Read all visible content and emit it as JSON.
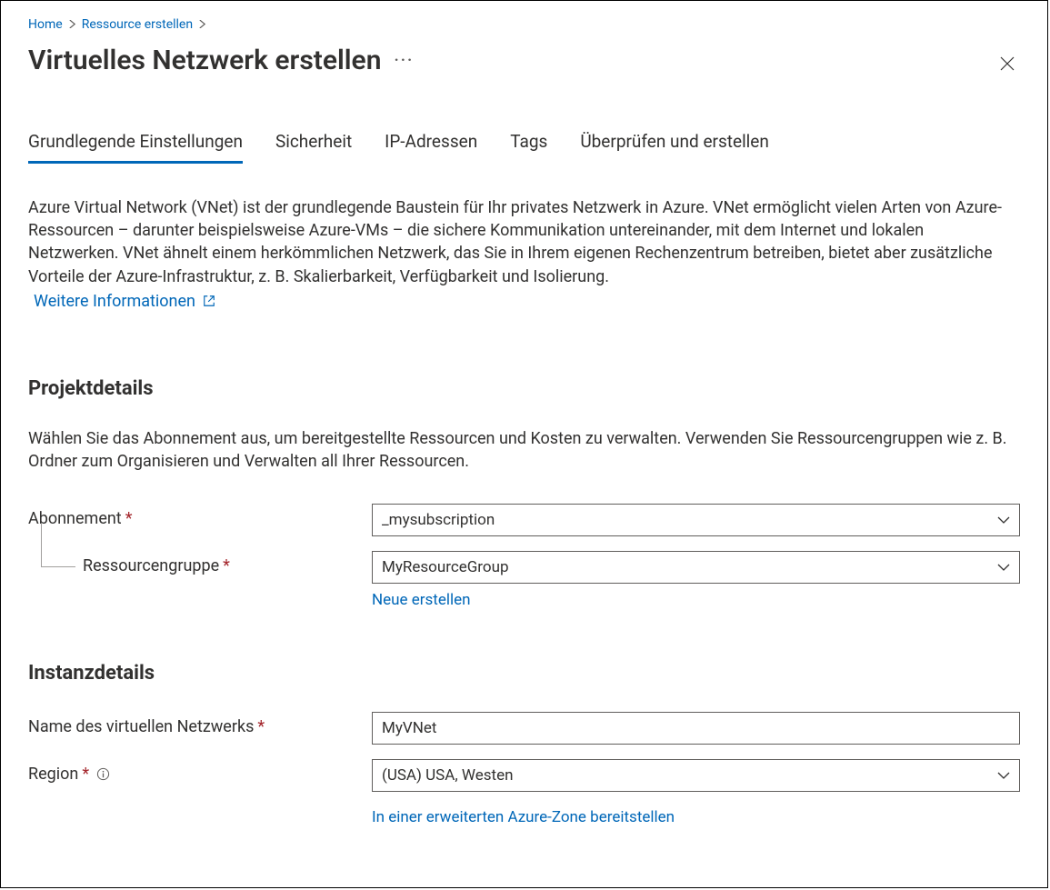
{
  "breadcrumb": {
    "home": "Home",
    "create": "Ressource erstellen"
  },
  "header": {
    "title": "Virtuelles Netzwerk erstellen"
  },
  "tabs": {
    "basics": "Grundlegende Einstellungen",
    "security": "Sicherheit",
    "ip": "IP-Adressen",
    "tags": "Tags",
    "review": "Überprüfen und erstellen"
  },
  "intro": {
    "text": "Azure Virtual Network (VNet) ist der grundlegende Baustein für Ihr privates Netzwerk in Azure. VNet ermöglicht vielen Arten von Azure-Ressourcen – darunter beispielsweise Azure-VMs – die sichere Kommunikation untereinander, mit dem Internet und lokalen Netzwerken. VNet ähnelt einem herkömmlichen Netzwerk, das Sie in Ihrem eigenen Rechenzentrum betreiben, bietet aber zusätzliche Vorteile der Azure-Infrastruktur, z. B. Skalierbarkeit, Verfügbarkeit und Isolierung.",
    "learn_more": "Weitere Informationen"
  },
  "project": {
    "title": "Projektdetails",
    "desc": "Wählen Sie das Abonnement aus, um bereitgestellte Ressourcen und Kosten zu verwalten. Verwenden Sie Ressourcengruppen wie z. B. Ordner zum Organisieren und Verwalten all Ihrer Ressourcen.",
    "subscription_label": "Abonnement",
    "subscription_value": "_mysubscription",
    "rg_label": "Ressourcengruppe",
    "rg_value": "MyResourceGroup",
    "rg_create_new": "Neue erstellen"
  },
  "instance": {
    "title": "Instanzdetails",
    "name_label": "Name des virtuellen Netzwerks",
    "name_value": "MyVNet",
    "region_label": "Region",
    "region_value": "(USA) USA, Westen",
    "extended_zone": "In einer erweiterten Azure-Zone bereitstellen"
  }
}
